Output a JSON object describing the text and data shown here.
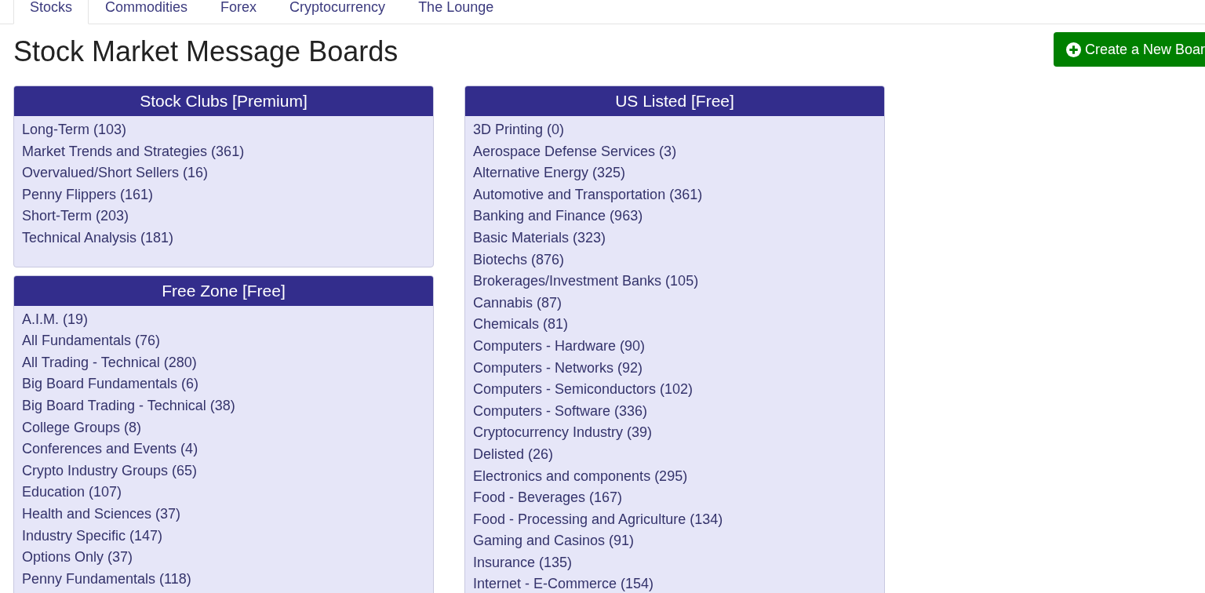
{
  "tabs": [
    {
      "label": "Stocks",
      "selected": true
    },
    {
      "label": "Commodities",
      "selected": false
    },
    {
      "label": "Forex",
      "selected": false
    },
    {
      "label": "Cryptocurrency",
      "selected": false
    },
    {
      "label": "The Lounge",
      "selected": false
    }
  ],
  "heading": "Stock Market Message Boards",
  "create_button": "Create a New Boar",
  "columns": [
    {
      "panels": [
        {
          "title": "Stock Clubs [Premium]",
          "boards": [
            "Long-Term (103)",
            "Market Trends and Strategies (361)",
            "Overvalued/Short Sellers (16)",
            "Penny Flippers (161)",
            "Short-Term (203)",
            "Technical Analysis (181)"
          ]
        },
        {
          "title": "Free Zone [Free]",
          "boards": [
            "A.I.M. (19)",
            "All Fundamentals (76)",
            "All Trading - Technical (280)",
            "Big Board Fundamentals (6)",
            "Big Board Trading - Technical (38)",
            "College Groups (8)",
            "Conferences and Events (4)",
            "Crypto Industry Groups (65)",
            "Education (107)",
            "Health and Sciences (37)",
            "Industry Specific (147)",
            "Options Only (37)",
            "Penny Fundamentals (118)"
          ]
        }
      ]
    },
    {
      "panels": [
        {
          "title": "US Listed [Free]",
          "boards": [
            "3D Printing (0)",
            "Aerospace Defense Services (3)",
            "Alternative Energy (325)",
            "Automotive and Transportation (361)",
            "Banking and Finance (963)",
            "Basic Materials (323)",
            "Biotechs (876)",
            "Brokerages/Investment Banks (105)",
            "Cannabis (87)",
            "Chemicals (81)",
            "Computers - Hardware (90)",
            "Computers - Networks (92)",
            "Computers - Semiconductors (102)",
            "Computers - Software (336)",
            "Cryptocurrency Industry (39)",
            "Delisted (26)",
            "Electronics and components (295)",
            "Food - Beverages (167)",
            "Food - Processing and Agriculture (134)",
            "Gaming and Casinos (91)",
            "Insurance (135)",
            "Internet - E-Commerce (154)"
          ]
        }
      ]
    }
  ]
}
